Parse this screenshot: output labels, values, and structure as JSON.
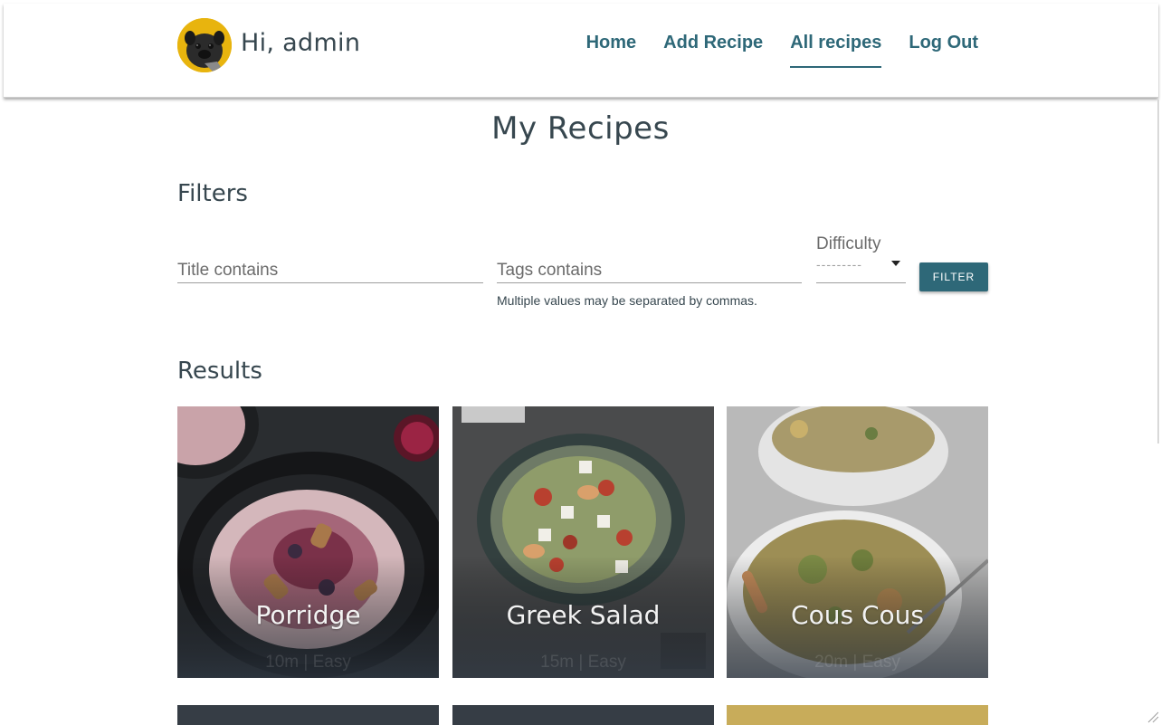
{
  "header": {
    "greeting": "Hi, admin",
    "nav": [
      {
        "label": "Home",
        "active": false
      },
      {
        "label": "Add Recipe",
        "active": false
      },
      {
        "label": "All recipes",
        "active": true
      },
      {
        "label": "Log Out",
        "active": false
      }
    ]
  },
  "main": {
    "page_title": "My Recipes",
    "filters": {
      "heading": "Filters",
      "title_placeholder": "Title contains",
      "tags_placeholder": "Tags contains",
      "tags_helper": "Multiple values may be separated by commas.",
      "difficulty_label": "Difficulty",
      "difficulty_value": "---------",
      "filter_button": "FILTER"
    },
    "results": {
      "heading": "Results",
      "cards": [
        {
          "title": "Porridge",
          "meta": "10m | Easy"
        },
        {
          "title": "Greek Salad",
          "meta": "15m | Easy"
        },
        {
          "title": "Cous Cous",
          "meta": "20m | Easy"
        }
      ]
    }
  },
  "colors": {
    "accent": "#2e6878",
    "text": "#37474f",
    "avatar_bg": "#e8b40e"
  }
}
